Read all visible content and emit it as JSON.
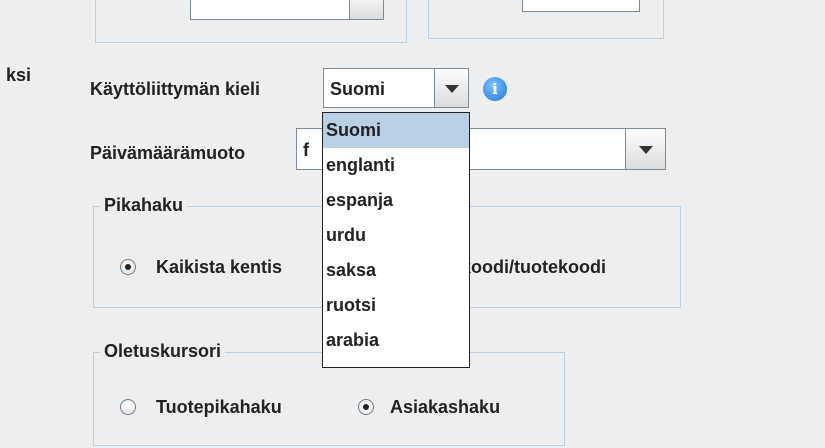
{
  "left_edge_label": "ksi",
  "ui_language": {
    "label": "Käyttöliittymän kieli",
    "selected": "Suomi",
    "options": [
      "Suomi",
      "englanti",
      "espanja",
      "urdu",
      "saksa",
      "ruotsi",
      "arabia"
    ]
  },
  "date_format": {
    "label": "Päivämäärämuoto",
    "value_visible": "f"
  },
  "quick_search": {
    "title": "Pikahaku",
    "option_left": "Kaikista kentis",
    "option_right_visible": "koodi/tuotekoodi"
  },
  "default_cursor": {
    "title": "Oletuskursori",
    "options": [
      {
        "label": "Tuotepikahaku"
      },
      {
        "label": "Asiakashaku"
      }
    ]
  },
  "colors": {
    "background": "#eeeeee",
    "group_border": "#b8cfe5",
    "selection": "#b8cfe5",
    "info_icon": "#1f77d6"
  }
}
